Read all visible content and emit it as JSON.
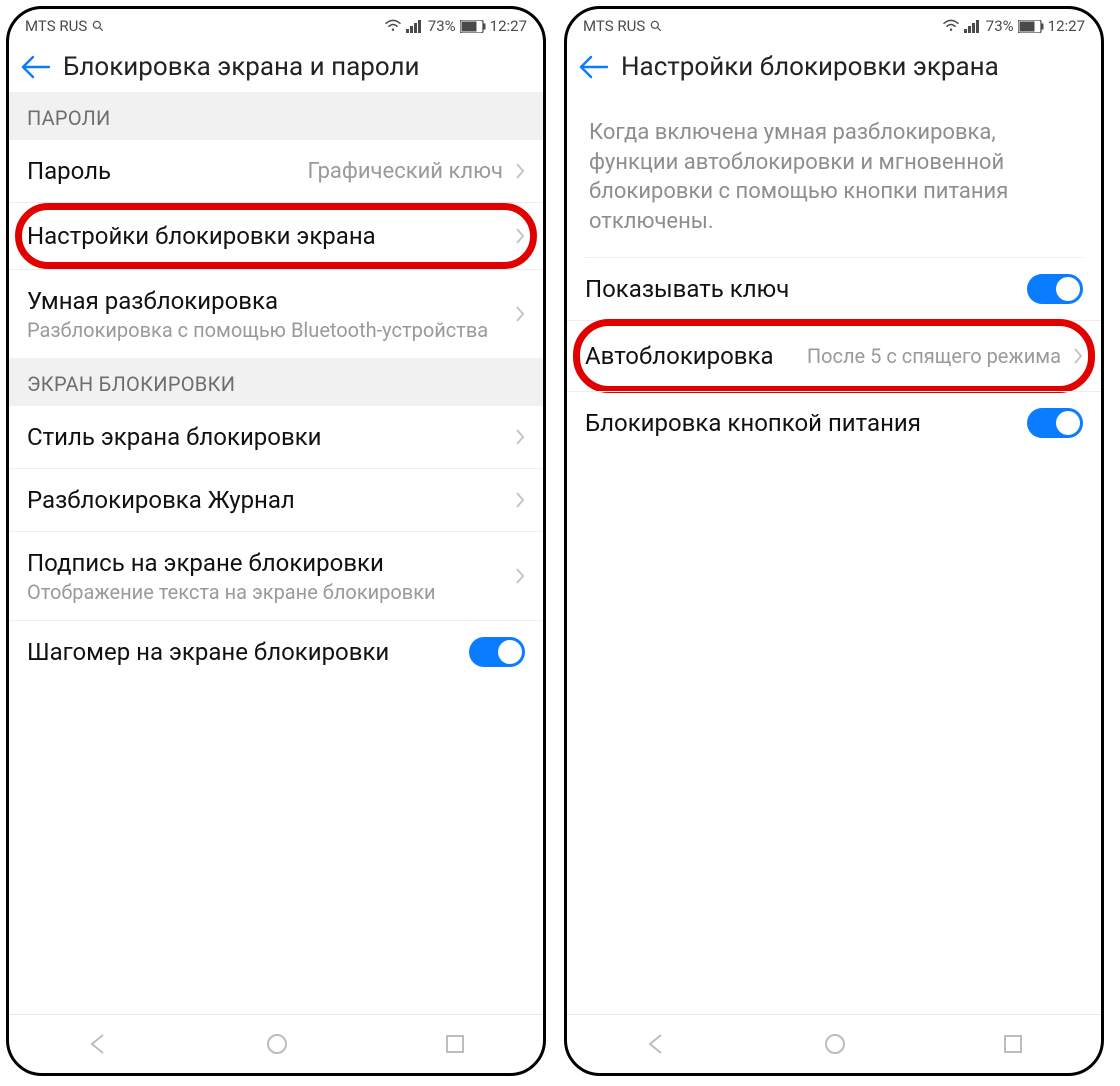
{
  "status": {
    "carrier": "MTS RUS",
    "battery": "73%",
    "time": "12:27"
  },
  "left": {
    "title": "Блокировка экрана и пароли",
    "section_passwords": "ПАРОЛИ",
    "row_password": {
      "label": "Пароль",
      "value": "Графический ключ"
    },
    "row_lock_settings": {
      "label": "Настройки блокировки экрана"
    },
    "row_smart": {
      "label": "Умная разблокировка",
      "sub": "Разблокировка с помощью Bluetooth-устройства"
    },
    "section_lockscreen": "ЭКРАН БЛОКИРОВКИ",
    "row_style": {
      "label": "Стиль экрана блокировки"
    },
    "row_journal": {
      "label": "Разблокировка Журнал"
    },
    "row_sign": {
      "label": "Подпись на экране блокировки",
      "sub": "Отображение текста на экране блокировки"
    },
    "row_steps": {
      "label": "Шагомер на экране блокировки"
    }
  },
  "right": {
    "title": "Настройки блокировки экрана",
    "help": "Когда включена умная разблокировка, функции автоблокировки и мгновенной блокировки с помощью кнопки питания отключены.",
    "row_showkey": {
      "label": "Показывать ключ"
    },
    "row_auto": {
      "label": "Автоблокировка",
      "value": "После 5 с спящего режима"
    },
    "row_power": {
      "label": "Блокировка кнопкой питания"
    }
  }
}
